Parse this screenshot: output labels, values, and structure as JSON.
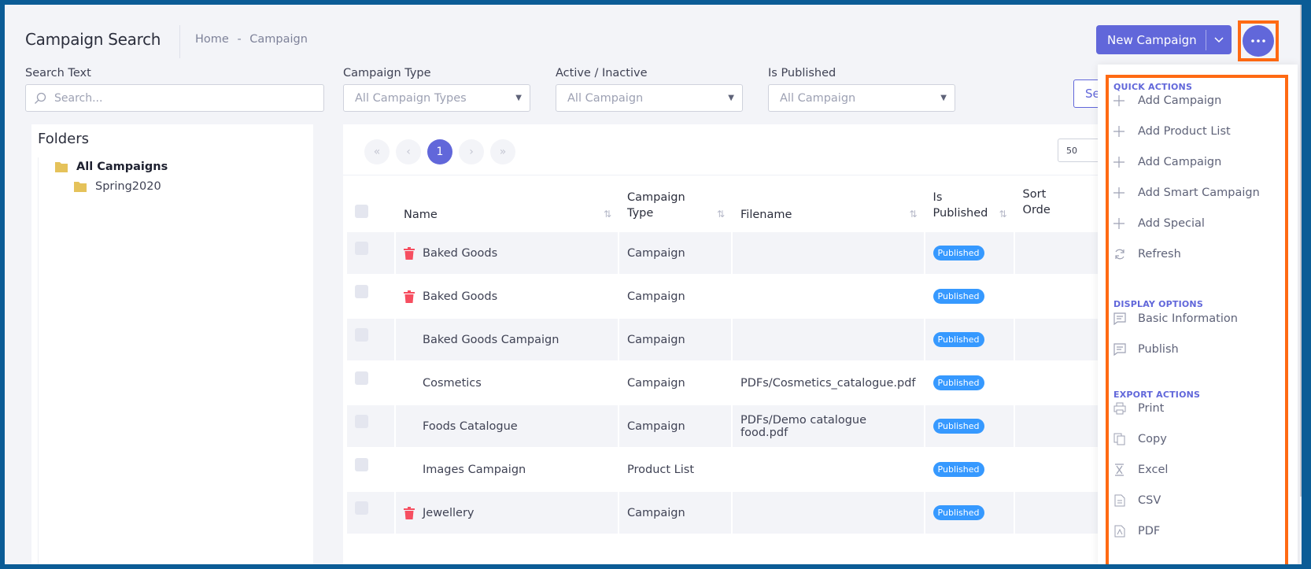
{
  "header": {
    "title": "Campaign Search",
    "breadcrumb": [
      "Home",
      "-",
      "Campaign"
    ],
    "new_button": "New Campaign"
  },
  "filters": {
    "search_label": "Search Text",
    "search_placeholder": "Search...",
    "type_label": "Campaign Type",
    "type_value": "All Campaign Types",
    "active_label": "Active / Inactive",
    "active_value": "All Campaign",
    "published_label": "Is Published",
    "published_value": "All Campaign",
    "search_button": "Se"
  },
  "folders": {
    "title": "Folders",
    "items": [
      "All Campaigns",
      "Spring2020"
    ]
  },
  "pager": {
    "current": "1",
    "page_size": "50"
  },
  "table": {
    "headers": [
      "Name",
      "Campaign Type",
      "Filename",
      "Is Published",
      "Sort Orde"
    ],
    "rows": [
      {
        "name": "Baked Goods",
        "type": "Campaign",
        "file": "",
        "status": "Published",
        "trash": true
      },
      {
        "name": "Baked Goods",
        "type": "Campaign",
        "file": "",
        "status": "Published",
        "trash": true
      },
      {
        "name": "Baked Goods Campaign",
        "type": "Campaign",
        "file": "",
        "status": "Published",
        "trash": false
      },
      {
        "name": "Cosmetics",
        "type": "Campaign",
        "file": "PDFs/Cosmetics_catalogue.pdf",
        "status": "Published",
        "trash": false
      },
      {
        "name": "Foods Catalogue",
        "type": "Campaign",
        "file": "PDFs/Demo catalogue food.pdf",
        "status": "Published",
        "trash": false
      },
      {
        "name": "Images Campaign",
        "type": "Product List",
        "file": "",
        "status": "Published",
        "trash": false
      },
      {
        "name": "Jewellery",
        "type": "Campaign",
        "file": "",
        "status": "Published",
        "trash": true
      }
    ]
  },
  "menu": {
    "quick_title": "QUICK ACTIONS",
    "quick": [
      "Add Campaign",
      "Add Product List",
      "Add Campaign",
      "Add Smart Campaign",
      "Add Special",
      "Refresh"
    ],
    "display_title": "DISPLAY OPTIONS",
    "display": [
      "Basic Information",
      "Publish"
    ],
    "export_title": "EXPORT ACTIONS",
    "export": [
      "Print",
      "Copy",
      "Excel",
      "CSV",
      "PDF"
    ]
  },
  "colors": {
    "accent": "#6167da",
    "highlight": "#ff6a13",
    "badge": "#3699ff",
    "danger": "#f64e60",
    "folder": "#e5c25a"
  }
}
